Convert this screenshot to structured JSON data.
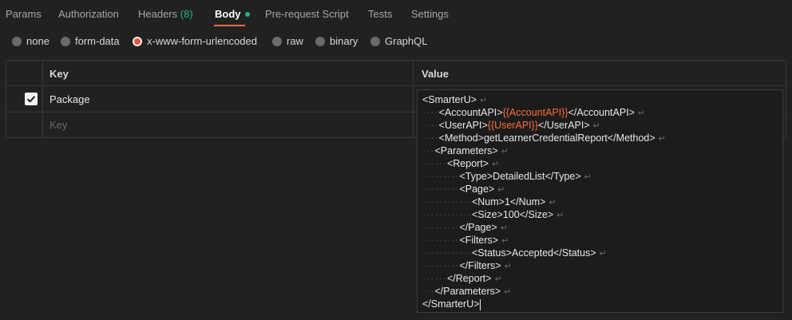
{
  "tabs": {
    "params": "Params",
    "authorization": "Authorization",
    "headers": "Headers",
    "headers_count": "(8)",
    "body": "Body",
    "prerequest": "Pre-request Script",
    "tests": "Tests",
    "settings": "Settings"
  },
  "body_types": {
    "none": "none",
    "form_data": "form-data",
    "urlencoded": "x-www-form-urlencoded",
    "raw": "raw",
    "binary": "binary",
    "graphql": "GraphQL",
    "selected": "x-www-form-urlencoded"
  },
  "table": {
    "key_header": "Key",
    "value_header": "Value",
    "row1_key": "Package",
    "row1_checked": true,
    "new_key_placeholder": "Key"
  },
  "editor": {
    "l1": "<SmarterU>",
    "l2a": "<AccountAPI>",
    "l2v": "{{AccountAPI}}",
    "l2b": "</AccountAPI>",
    "l3a": "<UserAPI>",
    "l3v": "{{UserAPI}}",
    "l3b": "</UserAPI>",
    "l4": "<Method>getLearnerCredentialReport</Method>",
    "l5": "<Parameters>",
    "l6": "<Report>",
    "l7": "<Type>DetailedList</Type>",
    "l8": "<Page>",
    "l9": "<Num>1</Num>",
    "l10": "<Size>100</Size>",
    "l11": "</Page>",
    "l12": "<Filters>",
    "l13": "<Status>Accepted</Status>",
    "l14": "</Filters>",
    "l15": "</Report>",
    "l16": "</Parameters>",
    "l17": "</SmarterU>",
    "newline_glyph": "↵",
    "whitespace_dot": "·"
  },
  "colors": {
    "accent": "#ff6c37",
    "green": "#26b47f",
    "background": "#212121"
  }
}
